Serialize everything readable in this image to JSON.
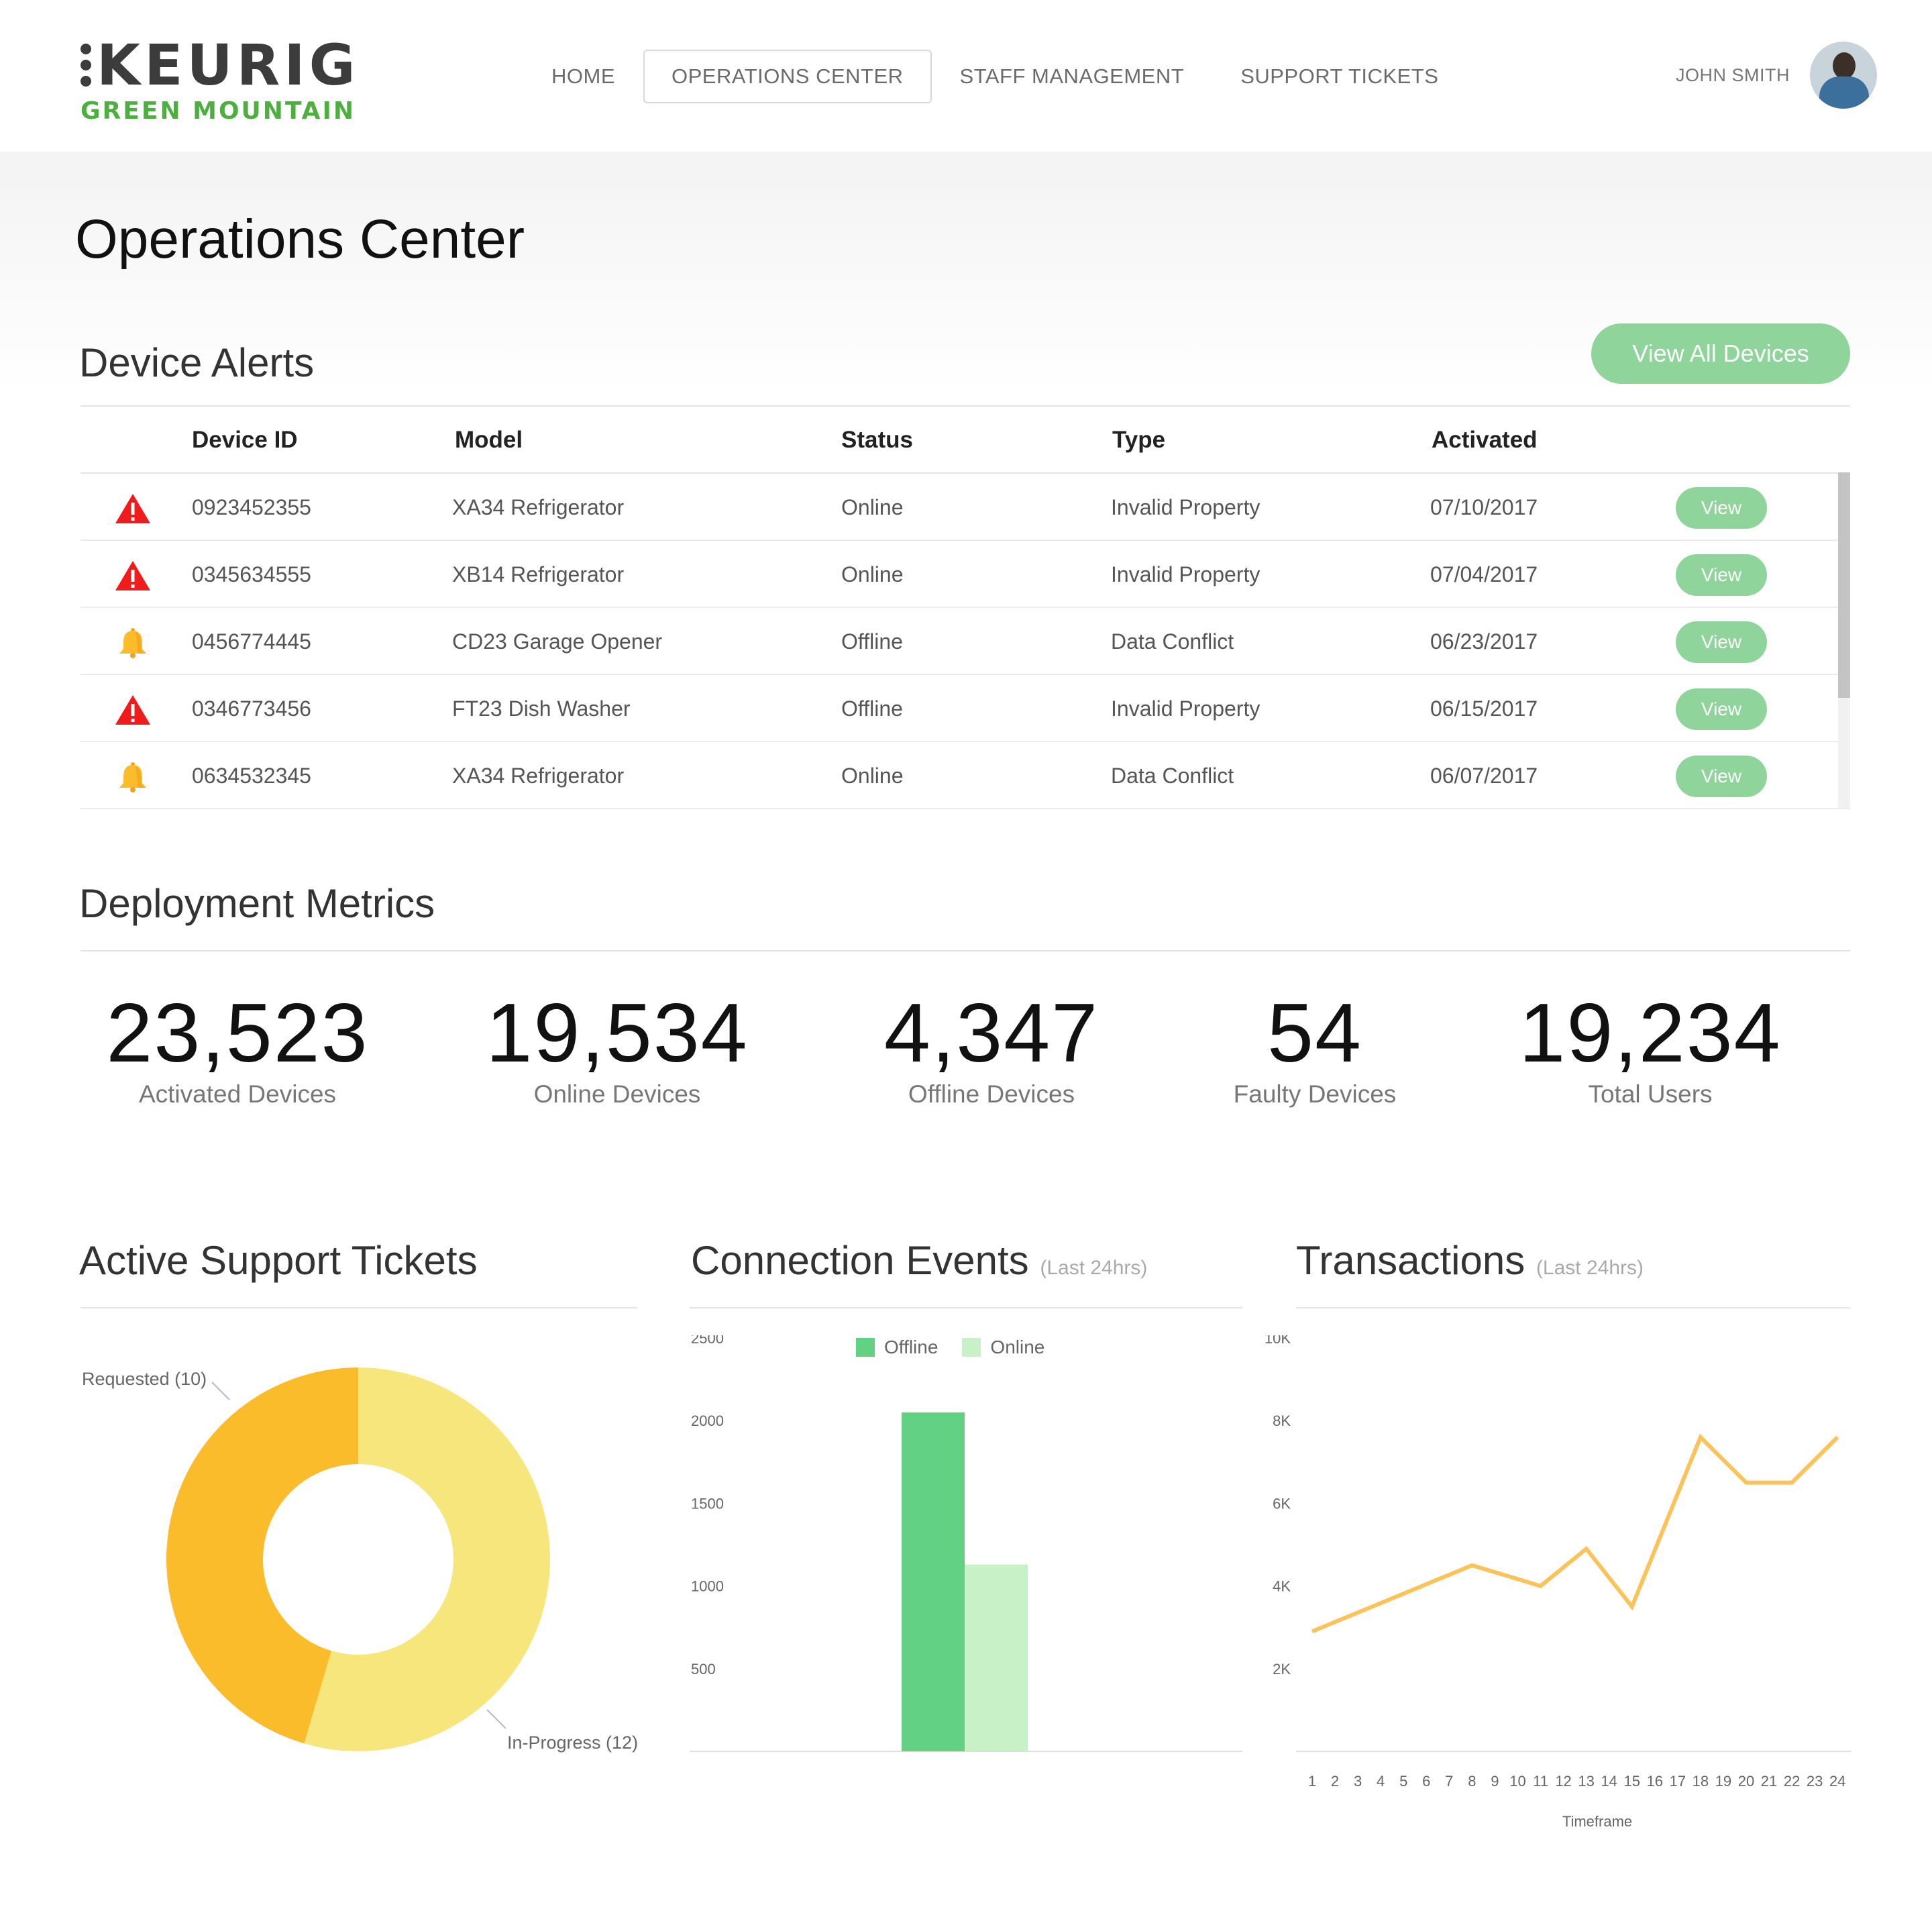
{
  "brand": {
    "name": "KEURIG",
    "sub": "GREEN MOUNTAIN",
    "accent": "#4caf3f"
  },
  "nav": {
    "items": [
      {
        "label": "HOME",
        "active": false
      },
      {
        "label": "OPERATIONS CENTER",
        "active": true
      },
      {
        "label": "STAFF MANAGEMENT",
        "active": false
      },
      {
        "label": "SUPPORT TICKETS",
        "active": false
      }
    ]
  },
  "user": {
    "name": "JOHN SMITH"
  },
  "page": {
    "title": "Operations Center"
  },
  "alerts": {
    "title": "Device Alerts",
    "view_all_label": "View All Devices",
    "columns": [
      "Device ID",
      "Model",
      "Status",
      "Type",
      "Activated"
    ],
    "rows": [
      {
        "icon": "warning-icon",
        "device_id": "0923452355",
        "model": "XA34 Refrigerator",
        "status": "Online",
        "type": "Invalid Property",
        "activated": "07/10/2017",
        "action": "View"
      },
      {
        "icon": "warning-icon",
        "device_id": "0345634555",
        "model": "XB14 Refrigerator",
        "status": "Online",
        "type": "Invalid Property",
        "activated": "07/04/2017",
        "action": "View"
      },
      {
        "icon": "bell-icon",
        "device_id": "0456774445",
        "model": "CD23 Garage Opener",
        "status": "Offline",
        "type": "Data Conflict",
        "activated": "06/23/2017",
        "action": "View"
      },
      {
        "icon": "warning-icon",
        "device_id": "0346773456",
        "model": "FT23 Dish Washer",
        "status": "Offline",
        "type": "Invalid Property",
        "activated": "06/15/2017",
        "action": "View"
      },
      {
        "icon": "bell-icon",
        "device_id": "0634532345",
        "model": "XA34 Refrigerator",
        "status": "Online",
        "type": "Data Conflict",
        "activated": "06/07/2017",
        "action": "View"
      }
    ]
  },
  "metrics": {
    "title": "Deployment Metrics",
    "items": [
      {
        "value": "23,523",
        "label": "Activated Devices"
      },
      {
        "value": "19,534",
        "label": "Online Devices"
      },
      {
        "value": "4,347",
        "label": "Offline Devices"
      },
      {
        "value": "54",
        "label": "Faulty Devices"
      },
      {
        "value": "19,234",
        "label": "Total Users"
      }
    ]
  },
  "tickets": {
    "title": "Active Support Tickets"
  },
  "connections": {
    "title": "Connection Events",
    "subtitle": "(Last 24hrs)"
  },
  "transactions": {
    "title": "Transactions",
    "subtitle": "(Last 24hrs)"
  },
  "chart_data": [
    {
      "type": "pie",
      "title": "Active Support Tickets",
      "donut": true,
      "slices": [
        {
          "label": "Requested (10)",
          "value": 10,
          "color": "#fbbc2c"
        },
        {
          "label": "In-Progress (12)",
          "value": 12,
          "color": "#f6e67c"
        }
      ]
    },
    {
      "type": "bar",
      "title": "Connection Events",
      "subtitle": "(Last 24hrs)",
      "categories": [
        ""
      ],
      "series": [
        {
          "name": "Offline",
          "values": [
            2050
          ],
          "color": "#63d184"
        },
        {
          "name": "Online",
          "values": [
            1130
          ],
          "color": "#c8f1c7"
        }
      ],
      "yticks": [
        500,
        1000,
        1500,
        2000,
        2500
      ],
      "ylim": [
        0,
        2500
      ],
      "legend": "top"
    },
    {
      "type": "line",
      "title": "Transactions",
      "subtitle": "(Last 24hrs)",
      "xlabel": "Timeframe",
      "x": [
        "1",
        "2",
        "3",
        "4",
        "5",
        "6",
        "7",
        "8",
        "9",
        "10",
        "11",
        "12",
        "13",
        "14",
        "15",
        "16",
        "17",
        "18",
        "19",
        "20",
        "21",
        "22",
        "23",
        "24"
      ],
      "yticks": [
        "2K",
        "4K",
        "6K",
        "8K",
        "10K"
      ],
      "ylim": [
        0,
        10000
      ],
      "points": [
        {
          "x": 1,
          "y": 2900
        },
        {
          "x": 8,
          "y": 4500
        },
        {
          "x": 11,
          "y": 4000
        },
        {
          "x": 13,
          "y": 4900
        },
        {
          "x": 15,
          "y": 3500
        },
        {
          "x": 18,
          "y": 7600
        },
        {
          "x": 20,
          "y": 6500
        },
        {
          "x": 22,
          "y": 6500
        },
        {
          "x": 24,
          "y": 7600
        }
      ],
      "color": "#fbc35a"
    }
  ]
}
